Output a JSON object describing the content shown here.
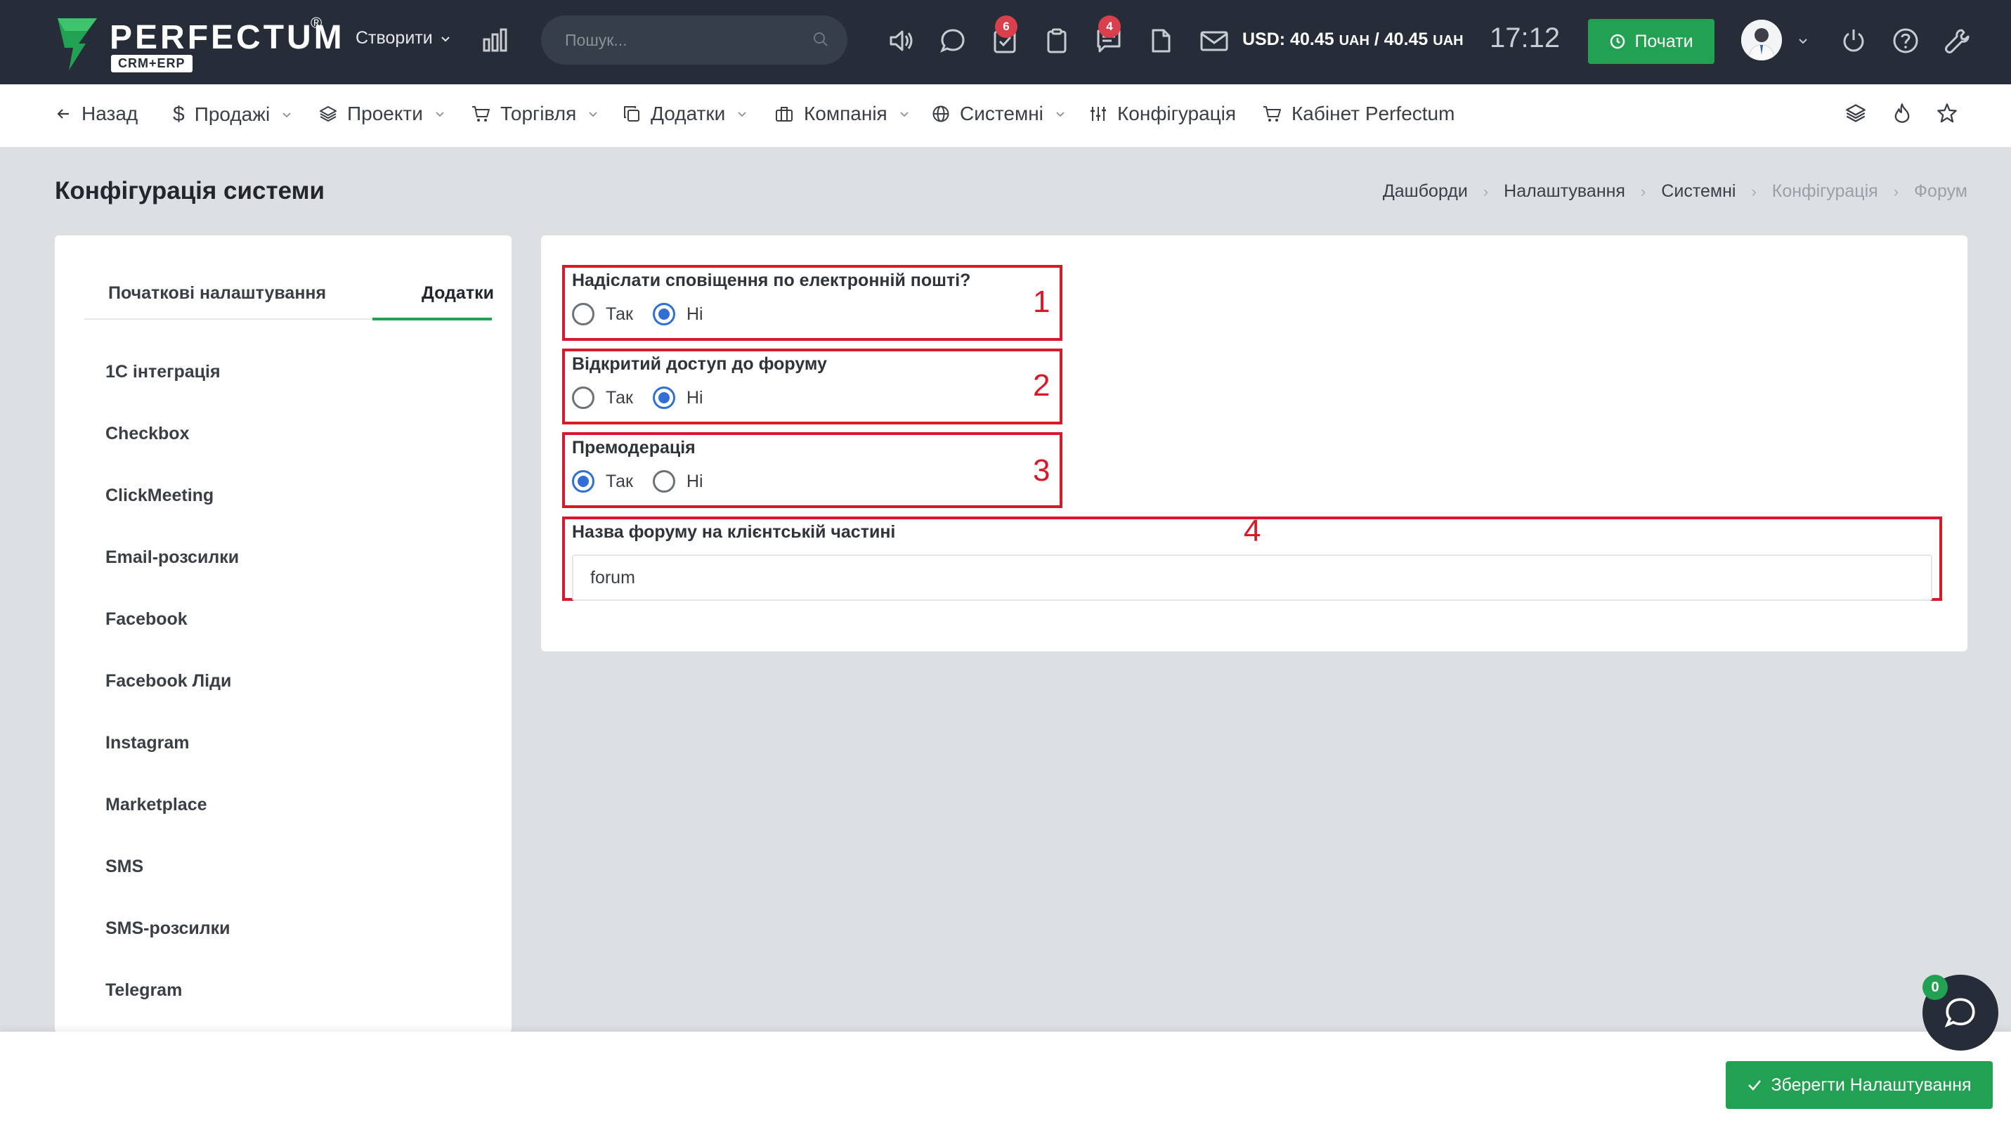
{
  "header": {
    "logo_text": "PERFECTUM",
    "logo_reg": "®",
    "logo_sub": "CRM+ERP",
    "create_label": "Створити",
    "search_placeholder": "Пошук...",
    "tasks_badge": "6",
    "messages_badge": "4",
    "currency_prefix": "USD: 40.45",
    "currency_unit1": "UAH",
    "currency_sep": " / 40.45",
    "currency_unit2": "UAH",
    "clock": "17:12",
    "start_label": "Почати"
  },
  "nav": {
    "back": "Назад",
    "sales": "Продажі",
    "projects": "Проекти",
    "trade": "Торгівля",
    "addons": "Додатки",
    "company": "Компанія",
    "system": "Системні",
    "config": "Конфігурація",
    "cabinet": "Кабінет Perfectum"
  },
  "page": {
    "title": "Конфігурація системи",
    "breadcrumb": [
      "Дашборди",
      "Налаштування",
      "Системні",
      "Конфігурація",
      "Форум"
    ]
  },
  "sidebar": {
    "tabs": [
      "Початкові налаштування",
      "Додатки"
    ],
    "items": [
      "1С інтеграція",
      "Checkbox",
      "ClickMeeting",
      "Email-розсилки",
      "Facebook",
      "Facebook Ліди",
      "Instagram",
      "Marketplace",
      "SMS",
      "SMS-розсилки",
      "Telegram"
    ]
  },
  "form": {
    "yes": "Так",
    "no": "Ні",
    "email_notify": {
      "label": "Надіслати сповіщення по електронній пошті?",
      "value": "Ні",
      "marker": "1"
    },
    "open_access": {
      "label": "Відкритий доступ до форуму",
      "value": "Ні",
      "marker": "2"
    },
    "premoderation": {
      "label": "Премодерація",
      "value": "Так",
      "marker": "3"
    },
    "forum_name": {
      "label": "Назва форуму на клієнтській частині",
      "value": "forum",
      "marker": "4"
    }
  },
  "footer": {
    "save_label": "Зберегти Налаштування",
    "chat_badge": "0"
  },
  "colors": {
    "topbar": "#262d38",
    "accent_green": "#23a152",
    "highlight_red": "#d7192a",
    "radio_blue": "#2f6fd6"
  },
  "icons": [
    "logo-mark",
    "chevron-down-icon",
    "stats-icon",
    "search-icon",
    "volume-icon",
    "chat-icon",
    "tasks-icon",
    "clipboard-icon",
    "messages-icon",
    "document-icon",
    "mail-icon",
    "clock-icon",
    "power-icon",
    "help-icon",
    "wrench-icon",
    "arrow-left-icon",
    "dollar-icon",
    "layers-icon",
    "cart-icon",
    "copy-icon",
    "building-icon",
    "globe-icon",
    "sliders-icon",
    "fire-icon",
    "star-icon",
    "check-icon"
  ]
}
